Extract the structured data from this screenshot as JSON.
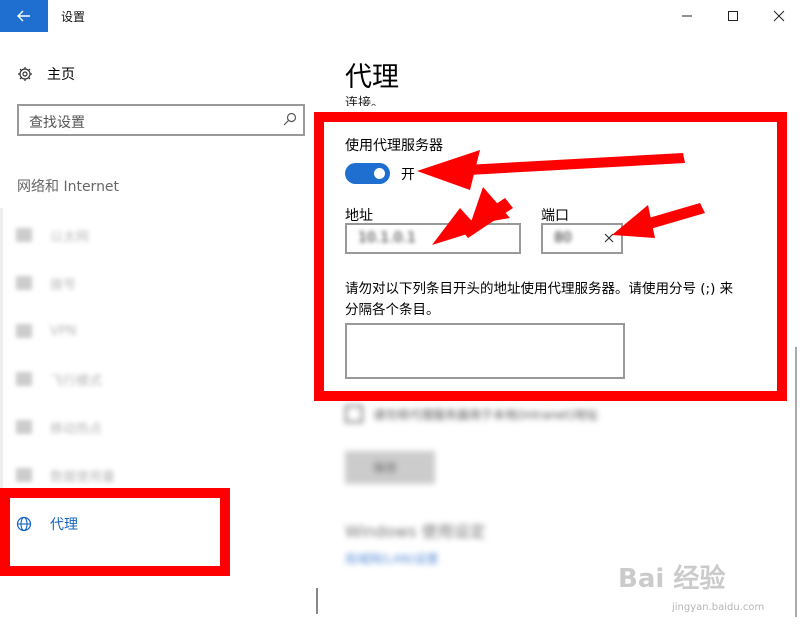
{
  "window": {
    "title": "设置",
    "minimize_glyph": "—",
    "maximize_glyph": "☐",
    "close_glyph": "✕"
  },
  "sidebar": {
    "home_label": "主页",
    "search_placeholder": "查找设置",
    "section_label": "网络和 Internet",
    "items": [
      {
        "label": "以太网",
        "icon": "ethernet-icon"
      },
      {
        "label": "拨号",
        "icon": "dialup-icon"
      },
      {
        "label": "VPN",
        "icon": "vpn-icon"
      },
      {
        "label": "飞行模式",
        "icon": "airplane-icon"
      },
      {
        "label": "移动热点",
        "icon": "hotspot-icon"
      },
      {
        "label": "数据使用量",
        "icon": "data-usage-icon"
      }
    ],
    "active_item": {
      "label": "代理",
      "icon": "globe-icon"
    }
  },
  "main": {
    "title": "代理",
    "clipped_text": "连接。",
    "use_proxy_label": "使用代理服务器",
    "toggle_state": "开",
    "address_label": "地址",
    "address_value": "10.1.0.1",
    "port_label": "端口",
    "port_value": "80",
    "exceptions_desc_line1": "请勿对以下列条目开头的地址使用代理服务器。请使用分号 (;) 来",
    "exceptions_desc_line2": "分隔各个条目。",
    "bypass_local_label": "请勿将代理服务器用于本地(Intranet)地址",
    "save_button": "保存",
    "windows_section": "Windows 使用设定",
    "windows_link": "局域网(LAN)设置"
  },
  "watermark": {
    "logo": "Bai 经验",
    "url": "jingyan.baidu.com"
  },
  "colors": {
    "accent": "#1f6fd0",
    "highlight": "#ff0000",
    "active_nav": "#1565c0"
  }
}
